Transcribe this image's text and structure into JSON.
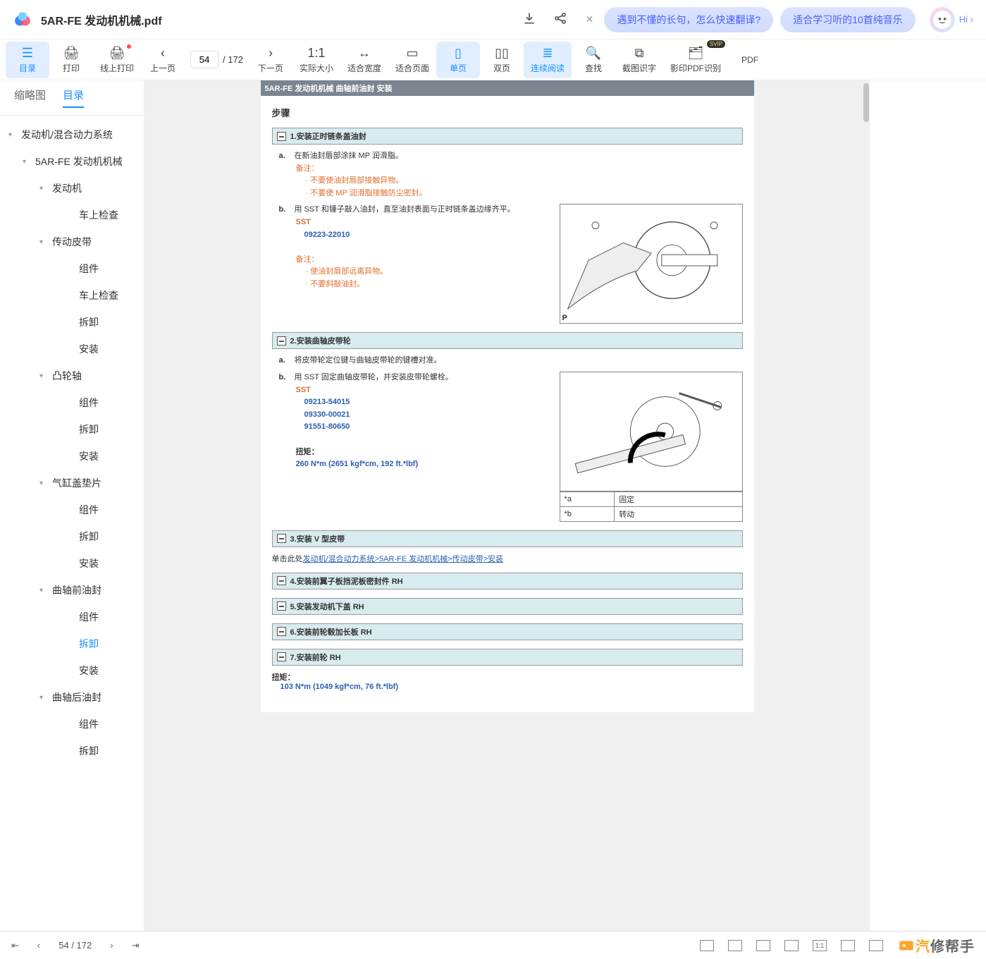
{
  "file": {
    "title": "5AR-FE 发动机机械.pdf"
  },
  "promos": {
    "p1": "遇到不懂的长句，怎么快速翻译?",
    "p2": "适合学习听的10首纯音乐",
    "hi": "Hi ›"
  },
  "toolbar": {
    "toc": "目录",
    "print": "打印",
    "online_print": "线上打印",
    "prev": "上一页",
    "next": "下一页",
    "actual": "实际大小",
    "fitw": "适合宽度",
    "fitp": "适合页面",
    "single": "单页",
    "double": "双页",
    "cont": "连续阅读",
    "search": "查找",
    "ocr": "截图识字",
    "scanpdf": "影印PDF识别",
    "pdf": "PDF",
    "svip": "SVIP",
    "page_cur": "54",
    "page_total": "/ 172"
  },
  "side_tabs": {
    "thumb": "缩略图",
    "toc": "目录"
  },
  "tree": [
    {
      "lv": 0,
      "label": "发动机/混合动力系统",
      "caret": "▾"
    },
    {
      "lv": 1,
      "label": "5AR-FE 发动机机械",
      "caret": "▾"
    },
    {
      "lv": 2,
      "label": "发动机",
      "caret": "▾"
    },
    {
      "lv": 3,
      "label": "车上检查"
    },
    {
      "lv": 2,
      "label": "传动皮带",
      "caret": "▾"
    },
    {
      "lv": 3,
      "label": "组件"
    },
    {
      "lv": 3,
      "label": "车上检查"
    },
    {
      "lv": 3,
      "label": "拆卸"
    },
    {
      "lv": 3,
      "label": "安装"
    },
    {
      "lv": 2,
      "label": "凸轮轴",
      "caret": "▾"
    },
    {
      "lv": 3,
      "label": "组件"
    },
    {
      "lv": 3,
      "label": "拆卸"
    },
    {
      "lv": 3,
      "label": "安装"
    },
    {
      "lv": 2,
      "label": "气缸盖垫片",
      "caret": "▾"
    },
    {
      "lv": 3,
      "label": "组件"
    },
    {
      "lv": 3,
      "label": "拆卸"
    },
    {
      "lv": 3,
      "label": "安装"
    },
    {
      "lv": 2,
      "label": "曲轴前油封",
      "caret": "▾"
    },
    {
      "lv": 3,
      "label": "组件"
    },
    {
      "lv": 3,
      "label": "拆卸",
      "sel": true
    },
    {
      "lv": 3,
      "label": "安装"
    },
    {
      "lv": 2,
      "label": "曲轴后油封",
      "caret": "▾"
    },
    {
      "lv": 3,
      "label": "组件"
    },
    {
      "lv": 3,
      "label": "拆卸"
    }
  ],
  "doc": {
    "header": "5AR-FE 发动机机械   曲轴前油封   安装",
    "steps_title": "步骤",
    "s1": {
      "t": "1.安装正时链条盖油封",
      "a": "在新油封唇部涂抹 MP 润滑脂。",
      "note": "备注：",
      "n1": "不要使油封唇部接触异物。",
      "n2": "不要使 MP 润滑脂接触防尘密封。",
      "b": "用 SST 和锤子敲入油封，直至油封表面与正时链条盖边缘齐平。",
      "sst": "SST",
      "sstn": "09223-22010",
      "note2": "备注：",
      "n3": "使油封唇部远离异物。",
      "n4": "不要斜敲油封。"
    },
    "s2": {
      "t": "2.安装曲轴皮带轮",
      "a": "将皮带轮定位键与曲轴皮带轮的键槽对准。",
      "b": "用 SST 固定曲轴皮带轮，并安装皮带轮螺栓。",
      "sst": "SST",
      "sstn1": "09213-54015",
      "sstn2": "09330-00021",
      "sstn3": "91551-80650",
      "tl": "扭矩：",
      "tv": "260 N*m (2651 kgf*cm, 192 ft.*lbf)",
      "ta": "*a",
      "tav": "固定",
      "tb": "*b",
      "tbv": "转动"
    },
    "s3": {
      "t": "3.安装 V 型皮带",
      "pre": "单击此处",
      "link": "发动机/混合动力系统>5AR-FE 发动机机械>传动皮带>安装"
    },
    "s4": {
      "t": "4.安装前翼子板挡泥板密封件 RH"
    },
    "s5": {
      "t": "5.安装发动机下盖 RH"
    },
    "s6": {
      "t": "6.安装前轮毂加长板 RH"
    },
    "s7": {
      "t": "7.安装前轮 RH",
      "tl": "扭矩：",
      "tv": "103 N*m (1049 kgf*cm, 76 ft.*lbf)"
    }
  },
  "bottom": {
    "page": "54  / 172"
  },
  "watermark": {
    "a": "汽",
    "b": "修帮手"
  }
}
